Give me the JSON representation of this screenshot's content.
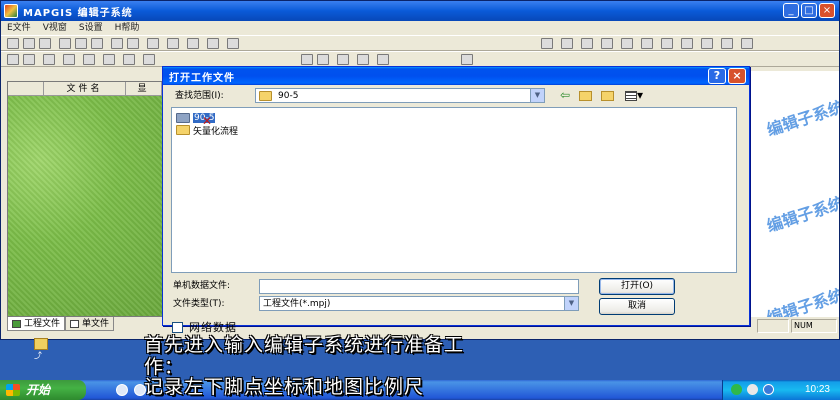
{
  "app": {
    "title": "MAPGIS 编辑子系统",
    "menu": [
      "E文件",
      "V视窗",
      "S设置",
      "H帮助"
    ]
  },
  "left_panel": {
    "columns": [
      "文件名",
      "显"
    ]
  },
  "bottom_tabs": [
    {
      "label": "工程文件",
      "icon": "project-file-icon"
    },
    {
      "label": "单文件",
      "icon": "single-file-icon"
    }
  ],
  "status_bar": {
    "num_indicator": "NUM"
  },
  "watermark": "编辑子系统",
  "dialog": {
    "title": "打开工作文件",
    "help_btn": "?",
    "close_btn": "×",
    "look_in": {
      "label": "查找范围(I):",
      "value": "90-5"
    },
    "files": [
      {
        "name": "90-5",
        "selected": true
      },
      {
        "name": "矢量化流程",
        "selected": false
      }
    ],
    "filename_label": "单机数据文件:",
    "filename_value": "",
    "filetype_label": "文件类型(T):",
    "filetype_value": "工程文件(*.mpj)",
    "open_btn": "打开(O)",
    "cancel_btn": "取消",
    "network_label": "网络数据"
  },
  "caption": {
    "line1": "首先进入输入编辑子系统进行准备工",
    "line2": "作：",
    "line3": "记录左下脚点坐标和地图比例尺"
  },
  "taskbar": {
    "start_label": "开始",
    "clock": "10:23"
  },
  "colors": {
    "title_blue": "#0a5ad8",
    "dialog_blue": "#0053ee",
    "selection": "#316ac5",
    "taskbar_green": "#3c9a3c"
  }
}
